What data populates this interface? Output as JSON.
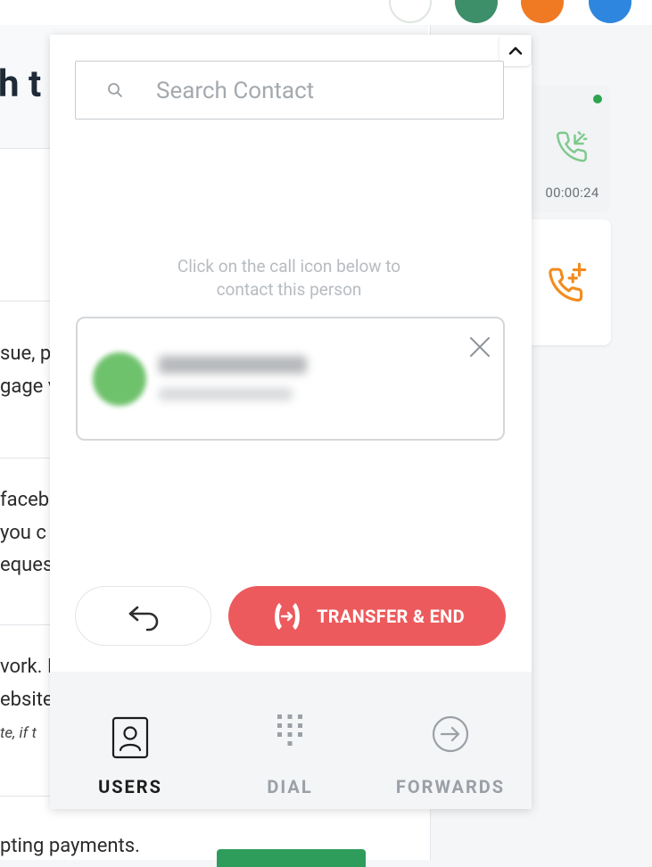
{
  "background": {
    "heading_fragment": "h t",
    "text_blocks": [
      [
        "sue, p",
        "gage v"
      ],
      [
        "faceb",
        "you c",
        "eques"
      ],
      [
        "vork. I",
        "ebsite",
        "te, if t"
      ],
      [
        "pting payments."
      ]
    ]
  },
  "active_call": {
    "timer": "00:00:24",
    "status_color": "#2ea44f"
  },
  "add_call": {
    "icon": "phone-add-icon"
  },
  "panel": {
    "collapse_icon": "chevron-up-icon",
    "search": {
      "placeholder": "Search Contact",
      "value": ""
    },
    "hint": {
      "line1": "Click on the call icon below to",
      "line2": "contact this person"
    },
    "selected_contact": {
      "avatar": "contact-avatar"
    },
    "back_icon": "back-arrow-icon",
    "transfer_label": "TRANSFER & END",
    "transfer_color": "#ec5a5d"
  },
  "nav": {
    "items": [
      {
        "label": "USERS",
        "icon": "user-icon",
        "active": true
      },
      {
        "label": "DIAL",
        "icon": "dialpad-icon",
        "active": false
      },
      {
        "label": "FORWARDS",
        "icon": "forward-icon",
        "active": false
      }
    ]
  }
}
